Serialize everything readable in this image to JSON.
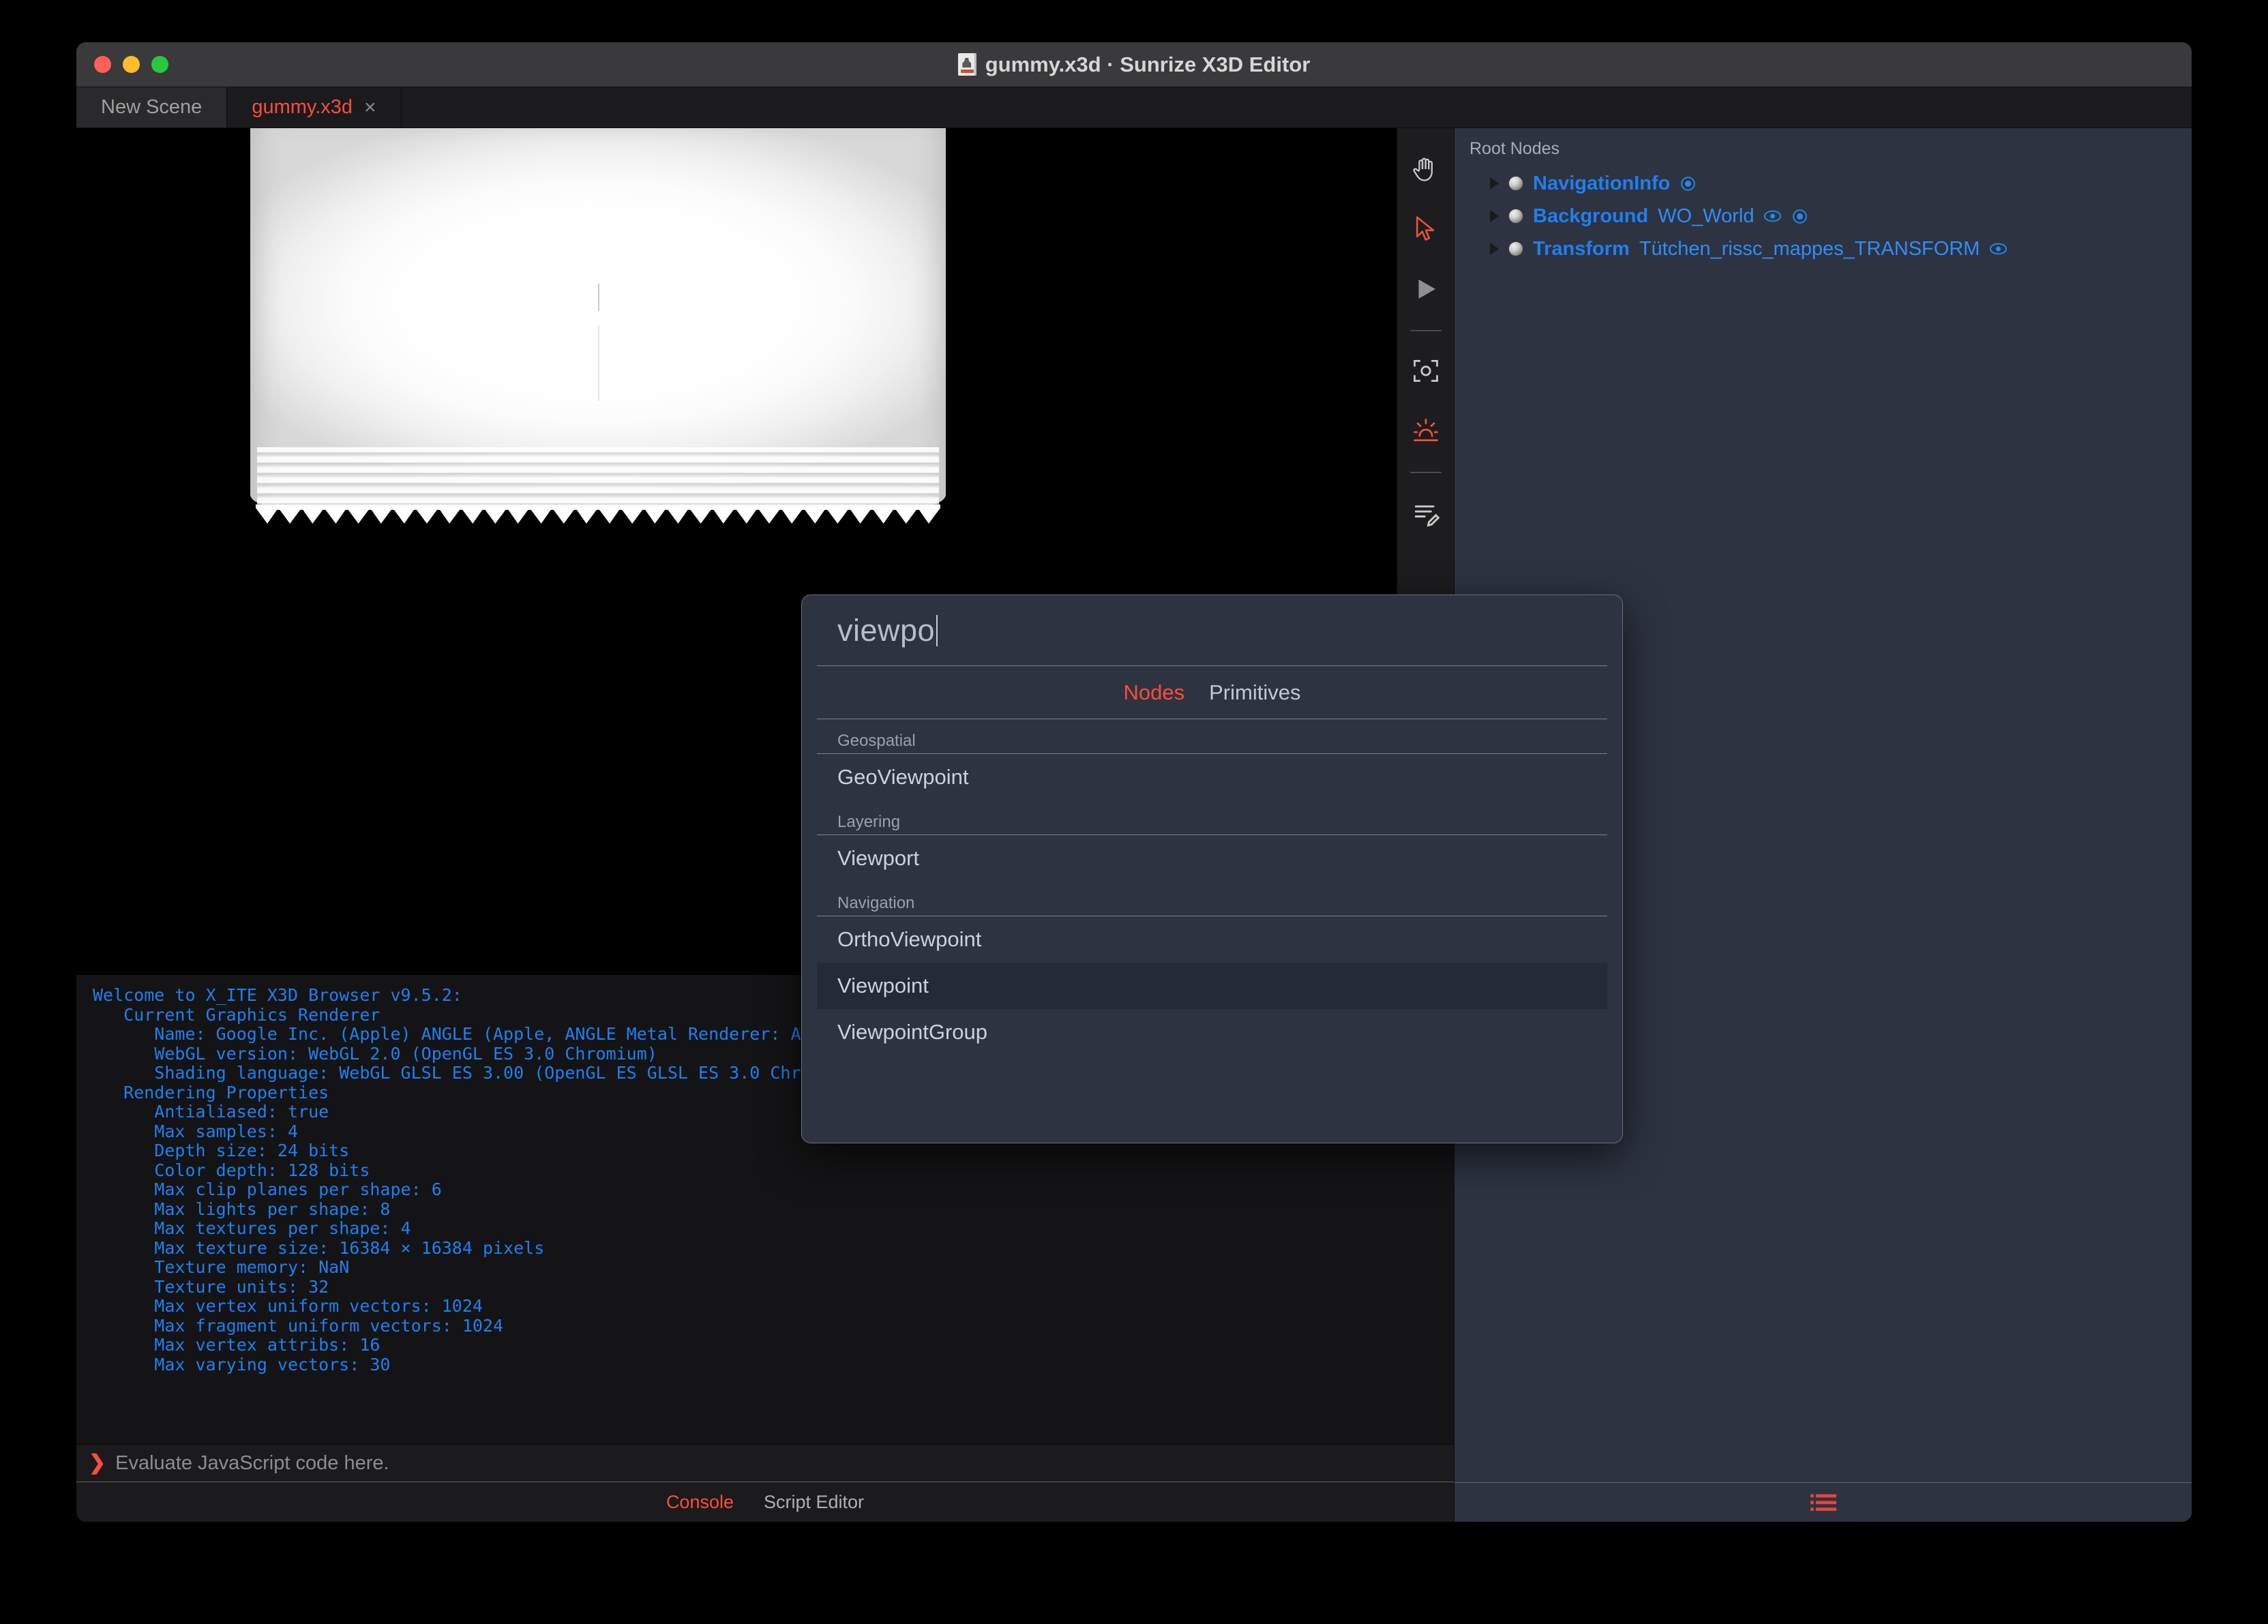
{
  "window": {
    "title": "gummy.x3d · Sunrize X3D Editor",
    "doc_icon": "x3d-document-icon",
    "traffic_lights": [
      "close",
      "minimize",
      "maximize"
    ]
  },
  "tabs": [
    {
      "label": "New Scene",
      "active": false,
      "closable": false
    },
    {
      "label": "gummy.x3d",
      "active": true,
      "closable": true,
      "close_glyph": "×"
    }
  ],
  "toolbar": {
    "items": [
      {
        "name": "hand-tool",
        "color": "#c9c9c9"
      },
      {
        "name": "arrow-select-tool",
        "color": "#f0503c"
      },
      {
        "name": "play-tool",
        "color": "#8f8f8f"
      },
      {
        "name": "separator-1"
      },
      {
        "name": "viewpoint-frame-tool",
        "color": "#c9c9c9"
      },
      {
        "name": "sunrise-tool",
        "color": "#f0503c"
      },
      {
        "name": "separator-2"
      },
      {
        "name": "edit-script-tool",
        "color": "#c9c9c9"
      }
    ]
  },
  "outline": {
    "title": "Root Nodes",
    "nodes": [
      {
        "type": "NavigationInfo",
        "name": "",
        "icons": [
          "bound-circle"
        ]
      },
      {
        "type": "Background",
        "name": "WO_World",
        "icons": [
          "eye",
          "bound-circle"
        ]
      },
      {
        "type": "Transform",
        "name": "Tütchen_rissc_mappes_TRANSFORM",
        "icons": [
          "eye"
        ]
      }
    ]
  },
  "console": {
    "log": "Welcome to X_ITE X3D Browser v9.5.2:\n   Current Graphics Renderer\n      Name: Google Inc. (Apple) ANGLE (Apple, ANGLE Metal Renderer: Apple\n      WebGL version: WebGL 2.0 (OpenGL ES 3.0 Chromium)\n      Shading language: WebGL GLSL ES 3.00 (OpenGL ES GLSL ES 3.0 Chromium\n   Rendering Properties\n      Antialiased: true\n      Max samples: 4\n      Depth size: 24 bits\n      Color depth: 128 bits\n      Max clip planes per shape: 6\n      Max lights per shape: 8\n      Max textures per shape: 4\n      Max texture size: 16384 × 16384 pixels\n      Texture memory: NaN\n      Texture units: 32\n      Max vertex uniform vectors: 1024\n      Max fragment uniform vectors: 1024\n      Max vertex attribs: 16\n      Max varying vectors: 30",
    "prompt_chevron": "❯",
    "prompt_placeholder": "Evaluate JavaScript code here.",
    "bottom_tabs": [
      {
        "label": "Console",
        "active": true
      },
      {
        "label": "Script Editor",
        "active": false
      }
    ]
  },
  "panel_footer": {
    "list_icon": "list-view-icon",
    "icon_color": "#e8443a"
  },
  "popup": {
    "query": "viewpo",
    "tabs": [
      {
        "label": "Nodes",
        "active": true
      },
      {
        "label": "Primitives",
        "active": false
      }
    ],
    "groups": [
      {
        "label": "Geospatial",
        "options": [
          {
            "label": "GeoViewpoint",
            "selected": false
          }
        ]
      },
      {
        "label": "Layering",
        "options": [
          {
            "label": "Viewport",
            "selected": false
          }
        ]
      },
      {
        "label": "Navigation",
        "options": [
          {
            "label": "OrthoViewpoint",
            "selected": false
          },
          {
            "label": "Viewpoint",
            "selected": true
          },
          {
            "label": "ViewpointGroup",
            "selected": false
          }
        ]
      }
    ]
  },
  "colors": {
    "accent_red": "#ff4c3b",
    "panel_bg": "#2d3340",
    "node_blue": "#1f8bfa",
    "console_blue": "#1f7ff0"
  }
}
